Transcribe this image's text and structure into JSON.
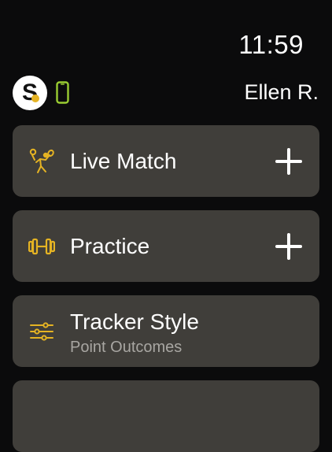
{
  "status_bar": {
    "time": "11:59"
  },
  "header": {
    "avatar_letter": "S",
    "user_name": "Ellen R."
  },
  "menu": [
    {
      "title": "Live Match",
      "icon": "tennis-player-icon",
      "action": "plus-icon"
    },
    {
      "title": "Practice",
      "icon": "dumbbell-icon",
      "action": "plus-icon"
    },
    {
      "title": "Tracker Style",
      "subtitle": "Point Outcomes",
      "icon": "sliders-icon"
    }
  ],
  "colors": {
    "background": "#0b0b0c",
    "card": "#403e3a",
    "accent": "#e5b323",
    "phone": "#9acd32",
    "subtitle": "#a8a6a2"
  }
}
